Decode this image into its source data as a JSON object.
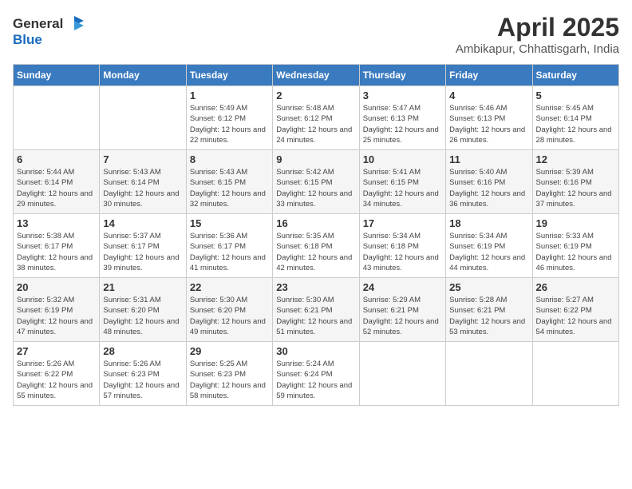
{
  "header": {
    "logo_general": "General",
    "logo_blue": "Blue",
    "month": "April 2025",
    "location": "Ambikapur, Chhattisgarh, India"
  },
  "weekdays": [
    "Sunday",
    "Monday",
    "Tuesday",
    "Wednesday",
    "Thursday",
    "Friday",
    "Saturday"
  ],
  "weeks": [
    [
      {
        "day": "",
        "sunrise": "",
        "sunset": "",
        "daylight": ""
      },
      {
        "day": "",
        "sunrise": "",
        "sunset": "",
        "daylight": ""
      },
      {
        "day": "1",
        "sunrise": "Sunrise: 5:49 AM",
        "sunset": "Sunset: 6:12 PM",
        "daylight": "Daylight: 12 hours and 22 minutes."
      },
      {
        "day": "2",
        "sunrise": "Sunrise: 5:48 AM",
        "sunset": "Sunset: 6:12 PM",
        "daylight": "Daylight: 12 hours and 24 minutes."
      },
      {
        "day": "3",
        "sunrise": "Sunrise: 5:47 AM",
        "sunset": "Sunset: 6:13 PM",
        "daylight": "Daylight: 12 hours and 25 minutes."
      },
      {
        "day": "4",
        "sunrise": "Sunrise: 5:46 AM",
        "sunset": "Sunset: 6:13 PM",
        "daylight": "Daylight: 12 hours and 26 minutes."
      },
      {
        "day": "5",
        "sunrise": "Sunrise: 5:45 AM",
        "sunset": "Sunset: 6:14 PM",
        "daylight": "Daylight: 12 hours and 28 minutes."
      }
    ],
    [
      {
        "day": "6",
        "sunrise": "Sunrise: 5:44 AM",
        "sunset": "Sunset: 6:14 PM",
        "daylight": "Daylight: 12 hours and 29 minutes."
      },
      {
        "day": "7",
        "sunrise": "Sunrise: 5:43 AM",
        "sunset": "Sunset: 6:14 PM",
        "daylight": "Daylight: 12 hours and 30 minutes."
      },
      {
        "day": "8",
        "sunrise": "Sunrise: 5:43 AM",
        "sunset": "Sunset: 6:15 PM",
        "daylight": "Daylight: 12 hours and 32 minutes."
      },
      {
        "day": "9",
        "sunrise": "Sunrise: 5:42 AM",
        "sunset": "Sunset: 6:15 PM",
        "daylight": "Daylight: 12 hours and 33 minutes."
      },
      {
        "day": "10",
        "sunrise": "Sunrise: 5:41 AM",
        "sunset": "Sunset: 6:15 PM",
        "daylight": "Daylight: 12 hours and 34 minutes."
      },
      {
        "day": "11",
        "sunrise": "Sunrise: 5:40 AM",
        "sunset": "Sunset: 6:16 PM",
        "daylight": "Daylight: 12 hours and 36 minutes."
      },
      {
        "day": "12",
        "sunrise": "Sunrise: 5:39 AM",
        "sunset": "Sunset: 6:16 PM",
        "daylight": "Daylight: 12 hours and 37 minutes."
      }
    ],
    [
      {
        "day": "13",
        "sunrise": "Sunrise: 5:38 AM",
        "sunset": "Sunset: 6:17 PM",
        "daylight": "Daylight: 12 hours and 38 minutes."
      },
      {
        "day": "14",
        "sunrise": "Sunrise: 5:37 AM",
        "sunset": "Sunset: 6:17 PM",
        "daylight": "Daylight: 12 hours and 39 minutes."
      },
      {
        "day": "15",
        "sunrise": "Sunrise: 5:36 AM",
        "sunset": "Sunset: 6:17 PM",
        "daylight": "Daylight: 12 hours and 41 minutes."
      },
      {
        "day": "16",
        "sunrise": "Sunrise: 5:35 AM",
        "sunset": "Sunset: 6:18 PM",
        "daylight": "Daylight: 12 hours and 42 minutes."
      },
      {
        "day": "17",
        "sunrise": "Sunrise: 5:34 AM",
        "sunset": "Sunset: 6:18 PM",
        "daylight": "Daylight: 12 hours and 43 minutes."
      },
      {
        "day": "18",
        "sunrise": "Sunrise: 5:34 AM",
        "sunset": "Sunset: 6:19 PM",
        "daylight": "Daylight: 12 hours and 44 minutes."
      },
      {
        "day": "19",
        "sunrise": "Sunrise: 5:33 AM",
        "sunset": "Sunset: 6:19 PM",
        "daylight": "Daylight: 12 hours and 46 minutes."
      }
    ],
    [
      {
        "day": "20",
        "sunrise": "Sunrise: 5:32 AM",
        "sunset": "Sunset: 6:19 PM",
        "daylight": "Daylight: 12 hours and 47 minutes."
      },
      {
        "day": "21",
        "sunrise": "Sunrise: 5:31 AM",
        "sunset": "Sunset: 6:20 PM",
        "daylight": "Daylight: 12 hours and 48 minutes."
      },
      {
        "day": "22",
        "sunrise": "Sunrise: 5:30 AM",
        "sunset": "Sunset: 6:20 PM",
        "daylight": "Daylight: 12 hours and 49 minutes."
      },
      {
        "day": "23",
        "sunrise": "Sunrise: 5:30 AM",
        "sunset": "Sunset: 6:21 PM",
        "daylight": "Daylight: 12 hours and 51 minutes."
      },
      {
        "day": "24",
        "sunrise": "Sunrise: 5:29 AM",
        "sunset": "Sunset: 6:21 PM",
        "daylight": "Daylight: 12 hours and 52 minutes."
      },
      {
        "day": "25",
        "sunrise": "Sunrise: 5:28 AM",
        "sunset": "Sunset: 6:21 PM",
        "daylight": "Daylight: 12 hours and 53 minutes."
      },
      {
        "day": "26",
        "sunrise": "Sunrise: 5:27 AM",
        "sunset": "Sunset: 6:22 PM",
        "daylight": "Daylight: 12 hours and 54 minutes."
      }
    ],
    [
      {
        "day": "27",
        "sunrise": "Sunrise: 5:26 AM",
        "sunset": "Sunset: 6:22 PM",
        "daylight": "Daylight: 12 hours and 55 minutes."
      },
      {
        "day": "28",
        "sunrise": "Sunrise: 5:26 AM",
        "sunset": "Sunset: 6:23 PM",
        "daylight": "Daylight: 12 hours and 57 minutes."
      },
      {
        "day": "29",
        "sunrise": "Sunrise: 5:25 AM",
        "sunset": "Sunset: 6:23 PM",
        "daylight": "Daylight: 12 hours and 58 minutes."
      },
      {
        "day": "30",
        "sunrise": "Sunrise: 5:24 AM",
        "sunset": "Sunset: 6:24 PM",
        "daylight": "Daylight: 12 hours and 59 minutes."
      },
      {
        "day": "",
        "sunrise": "",
        "sunset": "",
        "daylight": ""
      },
      {
        "day": "",
        "sunrise": "",
        "sunset": "",
        "daylight": ""
      },
      {
        "day": "",
        "sunrise": "",
        "sunset": "",
        "daylight": ""
      }
    ]
  ]
}
